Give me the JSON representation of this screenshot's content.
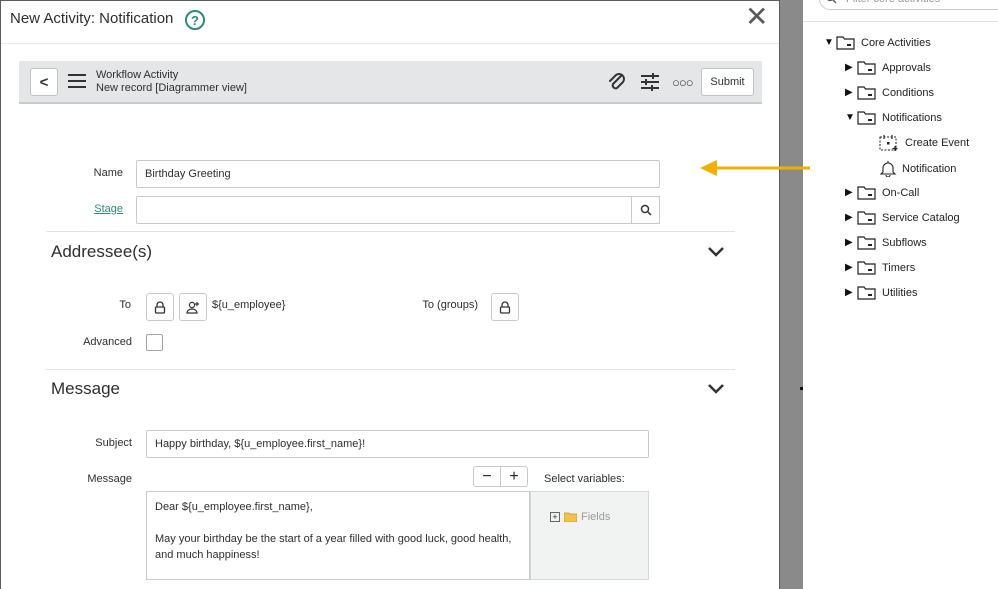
{
  "modal": {
    "title": "New Activity: Notification",
    "help_icon": "question-circle-icon",
    "close_icon": "close-icon"
  },
  "record_header": {
    "type": "Workflow Activity",
    "subtitle": "New record [Diagrammer view]",
    "submit_label": "Submit"
  },
  "form": {
    "name_label": "Name",
    "name_value": "Birthday Greeting",
    "stage_label": "Stage",
    "stage_value": ""
  },
  "addressees": {
    "title": "Addressee(s)",
    "to_label": "To",
    "to_value": "${u_employee}",
    "to_groups_label": "To (groups)",
    "advanced_label": "Advanced"
  },
  "message_section": {
    "title": "Message",
    "subject_label": "Subject",
    "subject_value": "Happy birthday, ${u_employee.first_name}!",
    "message_label": "Message",
    "message_line1": "Dear ${u_employee.first_name},",
    "message_line2": "May your birthday be the start of a year filled with good luck, good health, and much happiness!",
    "minus_label": "−",
    "plus_label": "+",
    "variables_label": "Select variables:",
    "fields_label": "Fields"
  },
  "palette": {
    "filter_placeholder": "Filter core activities",
    "root": "Core Activities",
    "items": [
      {
        "label": "Approvals"
      },
      {
        "label": "Conditions"
      },
      {
        "label": "Notifications"
      },
      {
        "label": "Create Event"
      },
      {
        "label": "Notification"
      },
      {
        "label": "On-Call"
      },
      {
        "label": "Service Catalog"
      },
      {
        "label": "Subflows"
      },
      {
        "label": "Timers"
      },
      {
        "label": "Utilities"
      }
    ]
  },
  "colors": {
    "accent": "#2c8a76",
    "arrow": "#f0b000",
    "header_bg": "#e4e6e7"
  }
}
